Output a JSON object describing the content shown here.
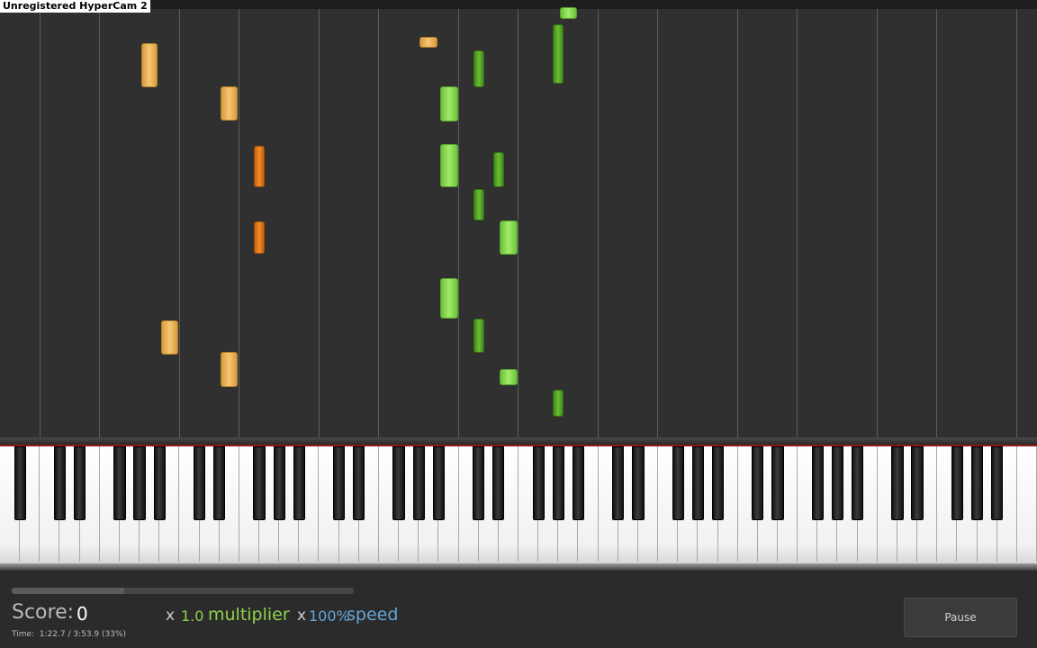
{
  "recorder": {
    "watermark": "Unregistered HyperCam 2"
  },
  "colors": {
    "light_orange": "#f6c873",
    "dark_orange": "#ee8e2a",
    "light_green": "#a2ec68",
    "dark_green": "#6cbd36",
    "multiplier_text": "#8ed24a",
    "speed_text": "#63a6d8"
  },
  "piano": {
    "white_key_count": 52
  },
  "footer": {
    "score_label": "Score:",
    "score_value": "0",
    "multiplier_x": "x",
    "multiplier_value": "1.0",
    "multiplier_label": "multiplier",
    "speed_x": "x",
    "speed_value": "100%",
    "speed_label": "speed",
    "time_label": "Time:",
    "time_value": "1:22.7  /  3:53.9 (33%)",
    "progress_fraction": 0.33,
    "pause_label": "Pause"
  }
}
